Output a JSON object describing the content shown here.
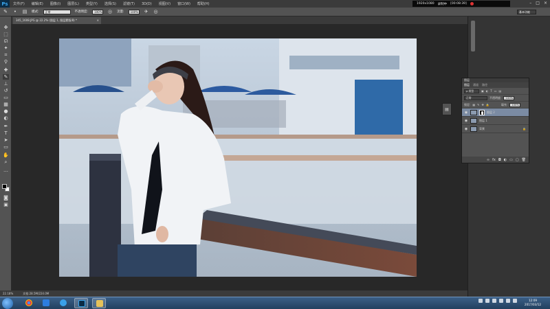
{
  "app": {
    "logo": "Ps",
    "menu": [
      "文件(F)",
      "编辑(E)",
      "图像(I)",
      "图层(L)",
      "类型(Y)",
      "选择(S)",
      "滤镜(T)",
      "3D(D)",
      "视图(V)",
      "窗口(W)",
      "帮助(H)"
    ],
    "window_buttons": [
      "–",
      "□",
      "×"
    ]
  },
  "recorder": {
    "resolution": "1920x1080",
    "label": "录制中",
    "time": "[00:08:39]"
  },
  "options": {
    "mode_label": "模式:",
    "mode_value": "正常",
    "opacity_label": "不透明度:",
    "opacity_value": "100%",
    "flow_label": "流量:",
    "flow_value": "100%",
    "workspace": "基本功能"
  },
  "document": {
    "tab_title": "345_1608.JPG @ 22.2% (图层 1, 图层蒙版/8) *",
    "zoom": "22.18%",
    "doc_size": "文档:28.5M/224.0M"
  },
  "layers_panel": {
    "panel_title": "图层",
    "tabs": [
      "图层",
      "通道",
      "路径"
    ],
    "filter_label": "ρ 类型",
    "blend_mode": "正常",
    "opacity_label": "不透明度:",
    "opacity_value": "100%",
    "lock_label": "锁定:",
    "fill_label": "填充:",
    "fill_value": "100%",
    "layers": [
      {
        "name": "图层 2",
        "active": true,
        "has_mask": true
      },
      {
        "name": "图层 1",
        "active": false,
        "has_mask": false
      },
      {
        "name": "背景",
        "active": false,
        "has_mask": false,
        "locked": true
      }
    ],
    "footer_icons": [
      "link-icon",
      "fx-icon",
      "mask-icon",
      "adjustment-icon",
      "group-icon",
      "new-layer-icon",
      "trash-icon"
    ]
  },
  "taskbar": {
    "apps": [
      "windows-start",
      "chrome",
      "feiq",
      "browser",
      "photoshop",
      "image-viewer"
    ],
    "tray_icons": 6,
    "clock_time": "12:09",
    "clock_date": "2017/03/12"
  }
}
